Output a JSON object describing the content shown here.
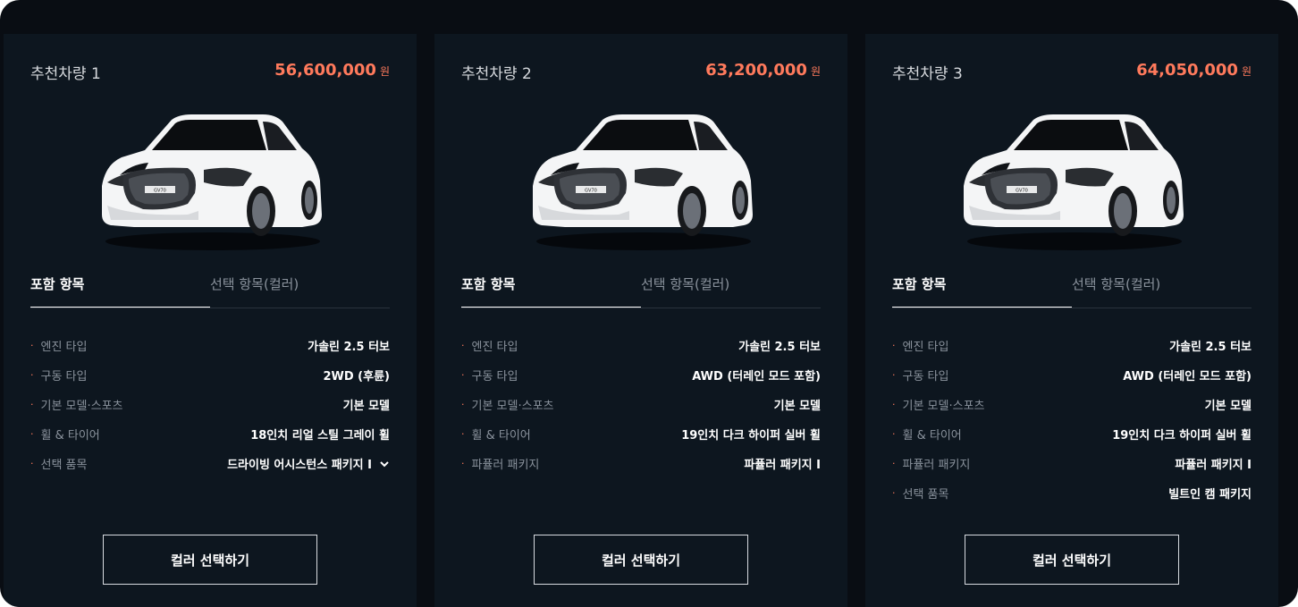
{
  "cards": [
    {
      "title": "추천차량 1",
      "price": "56,600,000",
      "price_unit": "원",
      "tabs": [
        "포함 항목",
        "선택 항목(컬러)"
      ],
      "specs": [
        {
          "label": "엔진 타입",
          "value": "가솔린 2.5 터보"
        },
        {
          "label": "구동 타입",
          "value": "2WD (후륜)"
        },
        {
          "label": "기본 모델·스포츠",
          "value": "기본 모델"
        },
        {
          "label": "휠 & 타이어",
          "value": "18인치 리얼 스틸 그레이 휠"
        },
        {
          "label": "선택 품목",
          "value": "드라이빙 어시스턴스 패키지 I",
          "has_dropdown": true
        }
      ],
      "button": "컬러 선택하기"
    },
    {
      "title": "추천차량 2",
      "price": "63,200,000",
      "price_unit": "원",
      "tabs": [
        "포함 항목",
        "선택 항목(컬러)"
      ],
      "specs": [
        {
          "label": "엔진 타입",
          "value": "가솔린 2.5 터보"
        },
        {
          "label": "구동 타입",
          "value": "AWD (터레인 모드 포함)"
        },
        {
          "label": "기본 모델·스포츠",
          "value": "기본 모델"
        },
        {
          "label": "휠 & 타이어",
          "value": "19인치 다크 하이퍼 실버 휠"
        },
        {
          "label": "파퓰러 패키지",
          "value": "파퓰러 패키지 I"
        }
      ],
      "button": "컬러 선택하기"
    },
    {
      "title": "추천차량 3",
      "price": "64,050,000",
      "price_unit": "원",
      "tabs": [
        "포함 항목",
        "선택 항목(컬러)"
      ],
      "specs": [
        {
          "label": "엔진 타입",
          "value": "가솔린 2.5 터보"
        },
        {
          "label": "구동 타입",
          "value": "AWD (터레인 모드 포함)"
        },
        {
          "label": "기본 모델·스포츠",
          "value": "기본 모델"
        },
        {
          "label": "휠 & 타이어",
          "value": "19인치 다크 하이퍼 실버 휠"
        },
        {
          "label": "파퓰러 패키지",
          "value": "파퓰러 패키지 I"
        },
        {
          "label": "선택 품목",
          "value": "빌트인 캠 패키지"
        }
      ],
      "button": "컬러 선택하기"
    }
  ],
  "car_badge": "GV70",
  "colors": {
    "background": "#090d13",
    "card": "#0d161f",
    "accent": "#ff7a5c",
    "text": "#ffffff",
    "muted": "#8a929c"
  }
}
